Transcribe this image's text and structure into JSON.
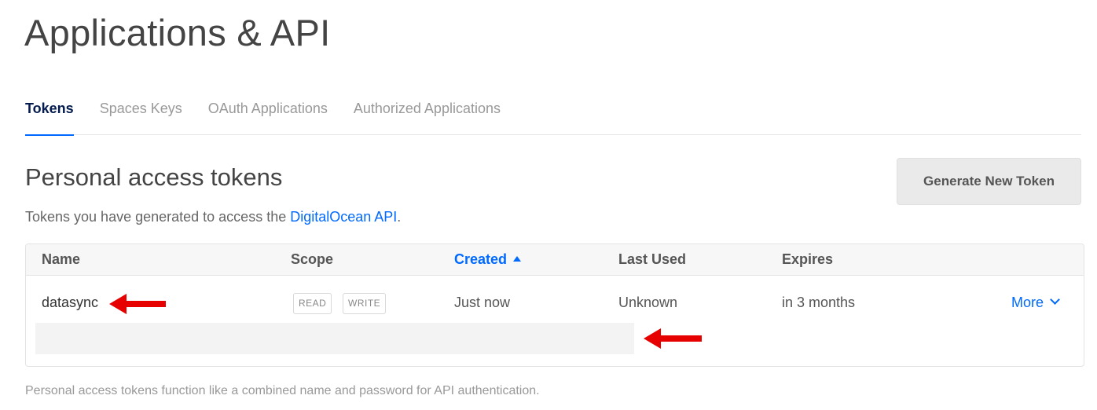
{
  "page": {
    "title": "Applications & API"
  },
  "tabs": [
    {
      "label": "Tokens",
      "active": true
    },
    {
      "label": "Spaces Keys",
      "active": false
    },
    {
      "label": "OAuth Applications",
      "active": false
    },
    {
      "label": "Authorized Applications",
      "active": false
    }
  ],
  "section": {
    "title": "Personal access tokens",
    "subtitle_prefix": "Tokens you have generated to access the ",
    "subtitle_link": "DigitalOcean API",
    "subtitle_suffix": ".",
    "generate_button": "Generate New Token",
    "footnote": "Personal access tokens function like a combined name and password for API authentication."
  },
  "table": {
    "columns": [
      "Name",
      "Scope",
      "Created",
      "Last Used",
      "Expires"
    ],
    "sorted_column": "Created",
    "sort_direction": "ascending",
    "rows": [
      {
        "name": "datasync",
        "scopes": [
          "READ",
          "WRITE"
        ],
        "created": "Just now",
        "last_used": "Unknown",
        "expires": "in 3 months",
        "actions_label": "More",
        "token_value": ""
      }
    ]
  },
  "colors": {
    "accent": "#0069ff",
    "active_tab": "#031b4e",
    "annotation_arrow": "#e60000"
  },
  "icons": {
    "sort": "caret-up-icon",
    "more": "chevron-down-icon",
    "annotation": "red-arrow-left-icon"
  }
}
